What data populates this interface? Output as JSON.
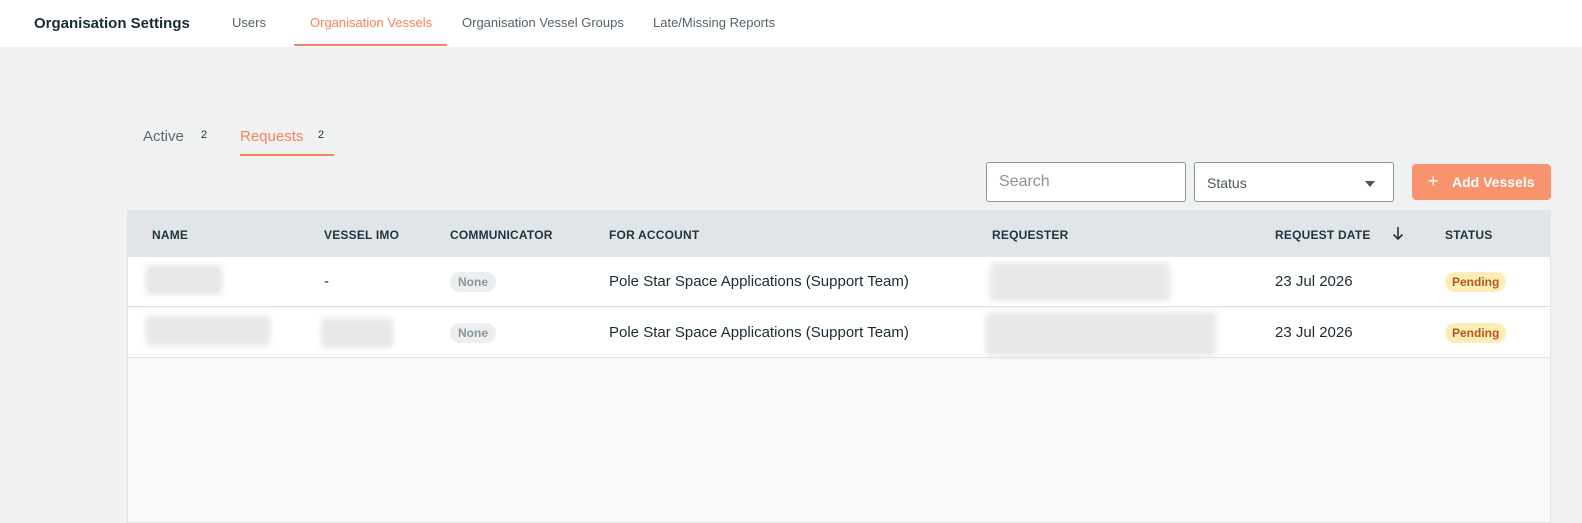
{
  "header": {
    "title": "Organisation Settings",
    "tabs": [
      {
        "label": "Users"
      },
      {
        "label": "Organisation Vessels"
      },
      {
        "label": "Organisation Vessel Groups"
      },
      {
        "label": "Late/Missing Reports"
      }
    ],
    "active_tab": "Organisation Vessels"
  },
  "subtabs": [
    {
      "label": "Active",
      "count": "2"
    },
    {
      "label": "Requests",
      "count": "2"
    }
  ],
  "active_subtab": "Requests",
  "toolbar": {
    "search_placeholder": "Search",
    "status_placeholder": "Status",
    "add_label": "Add Vessels",
    "add_icon": "plus-icon"
  },
  "table": {
    "columns": [
      "NAME",
      "VESSEL IMO",
      "COMMUNICATOR",
      "FOR ACCOUNT",
      "REQUESTER",
      "REQUEST DATE",
      "STATUS"
    ],
    "sorted_column": "REQUEST DATE",
    "sort_icon": "arrow-down-icon",
    "rows": [
      {
        "imo": "-",
        "communicator": "None",
        "account": "Pole Star Space Applications (Support Team)",
        "date": "23 Jul 2026",
        "status": "Pending"
      },
      {
        "imo": "",
        "communicator": "None",
        "account": "Pole Star Space Applications (Support Team)",
        "date": "23 Jul 2026",
        "status": "Pending"
      }
    ]
  },
  "colors": {
    "accent": "#f5845c",
    "button": "#f7936d",
    "pending_bg": "#fdeeb8",
    "pending_text": "#b4581e"
  }
}
